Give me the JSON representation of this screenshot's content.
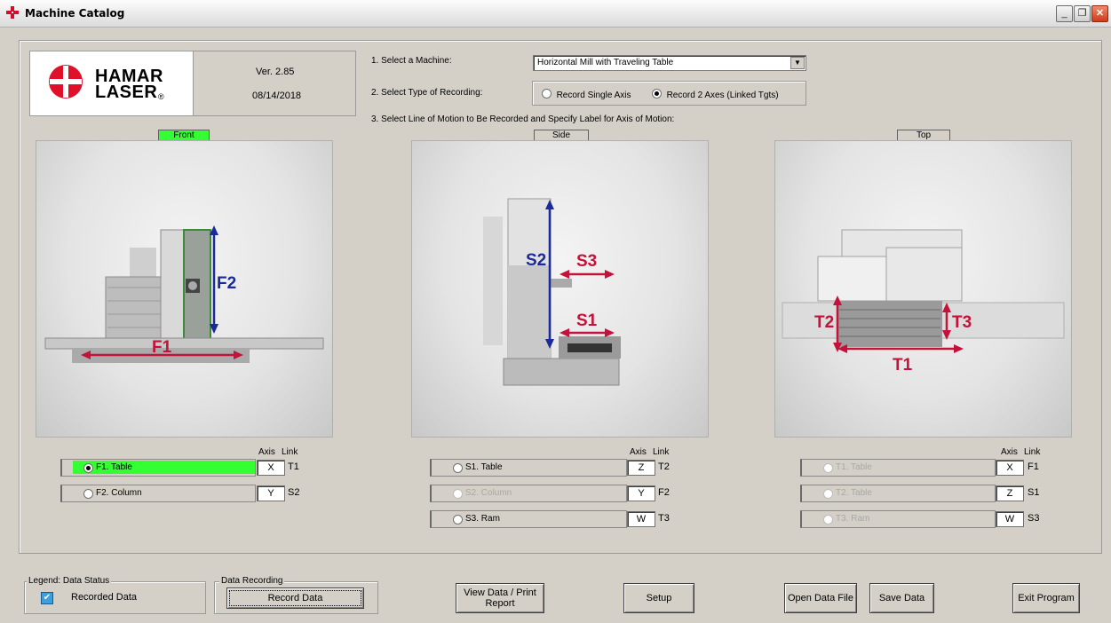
{
  "window": {
    "title": "Machine Catalog"
  },
  "logo": {
    "line1": "HAMAR",
    "line2": "LASER",
    "reg": "®"
  },
  "version": {
    "ver": "Ver. 2.85",
    "date": "08/14/2018"
  },
  "steps": {
    "step1": "1. Select a Machine:",
    "step2": "2. Select Type of Recording:",
    "step3": "3. Select Line of Motion to Be Recorded and Specify Label for Axis of Motion:"
  },
  "machine_select": {
    "value": "Horizontal Mill with Traveling Table"
  },
  "recording_type": {
    "opt1": "Record Single Axis",
    "opt2": "Record 2 Axes (Linked Tgts)",
    "selected": "opt2"
  },
  "views": {
    "front": {
      "tag": "Front",
      "img_labels": {
        "a": "F2",
        "b": "F1"
      },
      "axis_hdr": "Axis",
      "link_hdr": "Link",
      "rows": [
        {
          "label": "F1. Table",
          "axis": "X",
          "link": "T1",
          "selected": true,
          "enabled": true
        },
        {
          "label": "F2. Column",
          "axis": "Y",
          "link": "S2",
          "selected": false,
          "enabled": true
        }
      ]
    },
    "side": {
      "tag": "Side",
      "img_labels": {
        "a": "S2",
        "b": "S3",
        "c": "S1"
      },
      "axis_hdr": "Axis",
      "link_hdr": "Link",
      "rows": [
        {
          "label": "S1. Table",
          "axis": "Z",
          "link": "T2",
          "selected": false,
          "enabled": true
        },
        {
          "label": "S2. Column",
          "axis": "Y",
          "link": "F2",
          "selected": false,
          "enabled": false
        },
        {
          "label": "S3. Ram",
          "axis": "W",
          "link": "T3",
          "selected": false,
          "enabled": true
        }
      ]
    },
    "top": {
      "tag": "Top",
      "img_labels": {
        "a": "T2",
        "b": "T3",
        "c": "T1"
      },
      "axis_hdr": "Axis",
      "link_hdr": "Link",
      "rows": [
        {
          "label": "T1. Table",
          "axis": "X",
          "link": "F1",
          "selected": false,
          "enabled": false
        },
        {
          "label": "T2. Table",
          "axis": "Z",
          "link": "S1",
          "selected": false,
          "enabled": false
        },
        {
          "label": "T3. Ram",
          "axis": "W",
          "link": "S3",
          "selected": false,
          "enabled": false
        }
      ]
    }
  },
  "legend": {
    "title": "Legend: Data Status",
    "item": "Recorded Data",
    "checked": true
  },
  "data_recording": {
    "title": "Data Recording",
    "button": "Record Data"
  },
  "buttons": {
    "view_data": "View Data / Print Report",
    "setup": "Setup",
    "open": "Open Data File",
    "save": "Save Data",
    "exit": "Exit Program"
  },
  "colors": {
    "highlight": "#33ff33",
    "arrow_blue": "#1a2a9a",
    "arrow_red": "#c4123a",
    "brand_red": "#e0102a"
  }
}
